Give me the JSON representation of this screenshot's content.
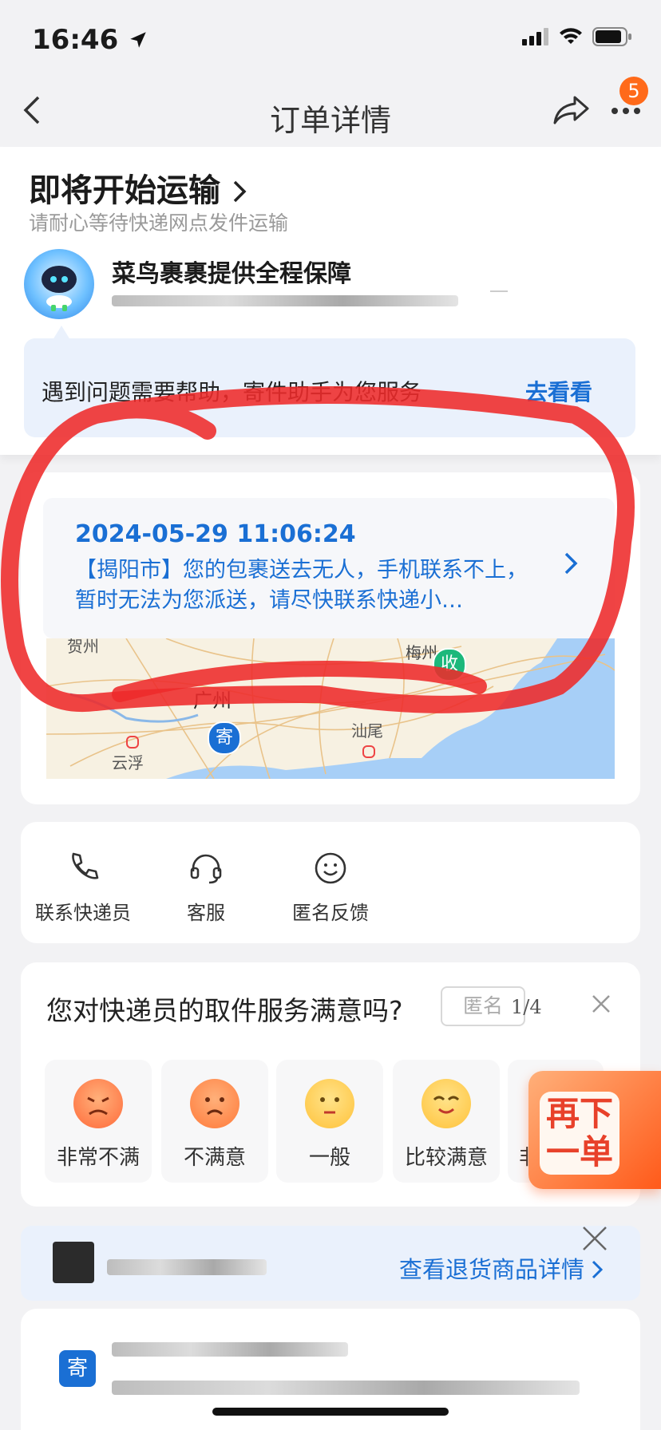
{
  "status_bar": {
    "time": "16:46"
  },
  "nav": {
    "title": "订单详情",
    "badge": "5"
  },
  "header": {
    "status_title": "即将开始运输",
    "status_sub": "请耐心等待快递网点发件运输",
    "guarantee": "菜鸟裹裹提供全程保障",
    "help_text": "遇到问题需要帮助，寄件助手为您服务",
    "help_link": "去看看"
  },
  "tracking": {
    "date": "2024-05-29 11:06:24",
    "message": "【揭阳市】您的包裹送去无人，手机联系不上，暂时无法为您派送，请尽快联系快递小…",
    "map_labels": {
      "hezhou": "贺州",
      "meizhou": "梅州",
      "guangzhou": "广州",
      "shanwei": "汕尾",
      "yunfu": "云浮"
    },
    "receive_pin": "收",
    "send_pin": "寄"
  },
  "actions": [
    {
      "label": "联系快递员",
      "icon": "phone-icon"
    },
    {
      "label": "客服",
      "icon": "headset-icon"
    },
    {
      "label": "匿名反馈",
      "icon": "smile-icon"
    }
  ],
  "survey": {
    "question": "您对快递员的取件服务满意吗?",
    "anon_label": "匿名",
    "pager": "1/4",
    "options": [
      {
        "label": "非常不满",
        "color": "#ff7a4a"
      },
      {
        "label": "不满意",
        "color": "#ff8a4a"
      },
      {
        "label": "一般",
        "color": "#ffc83a"
      },
      {
        "label": "比较满意",
        "color": "#ffc83a"
      },
      {
        "label": "非",
        "color": "#ffc83a"
      }
    ]
  },
  "reorder": {
    "label": "再下一单"
  },
  "return_bar": {
    "link": "查看退货商品详情"
  },
  "bottom": {
    "send_badge": "寄"
  },
  "colors": {
    "accent": "#1a6fd4",
    "orange": "#ff5a1a",
    "annotation": "#ee2a2a"
  }
}
